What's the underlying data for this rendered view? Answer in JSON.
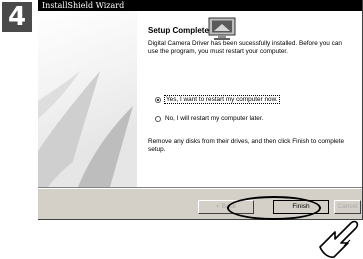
{
  "step": {
    "number": "4"
  },
  "window": {
    "title": "InstallShield Wizard",
    "heading": "Setup Complete",
    "intro": "Digital Camera Driver has been sucessfully installed. Before you can use the program, you must restart your computer.",
    "options": [
      {
        "label": "Yes, I want to restart my computer now.",
        "selected": true
      },
      {
        "label": "No, I will restart my computer later.",
        "selected": false
      }
    ],
    "instructions": "Remove any disks from their drives, and then click Finish to complete setup.",
    "buttons": {
      "back": "< Back",
      "finish": "Finish",
      "cancel": "Cancel"
    }
  },
  "colors": {
    "titlebar": "#000000",
    "dialog": "#d4d0c8",
    "badge": "#4a4a4a"
  },
  "icons": [
    "computer-icon",
    "hand-pointer-icon"
  ]
}
